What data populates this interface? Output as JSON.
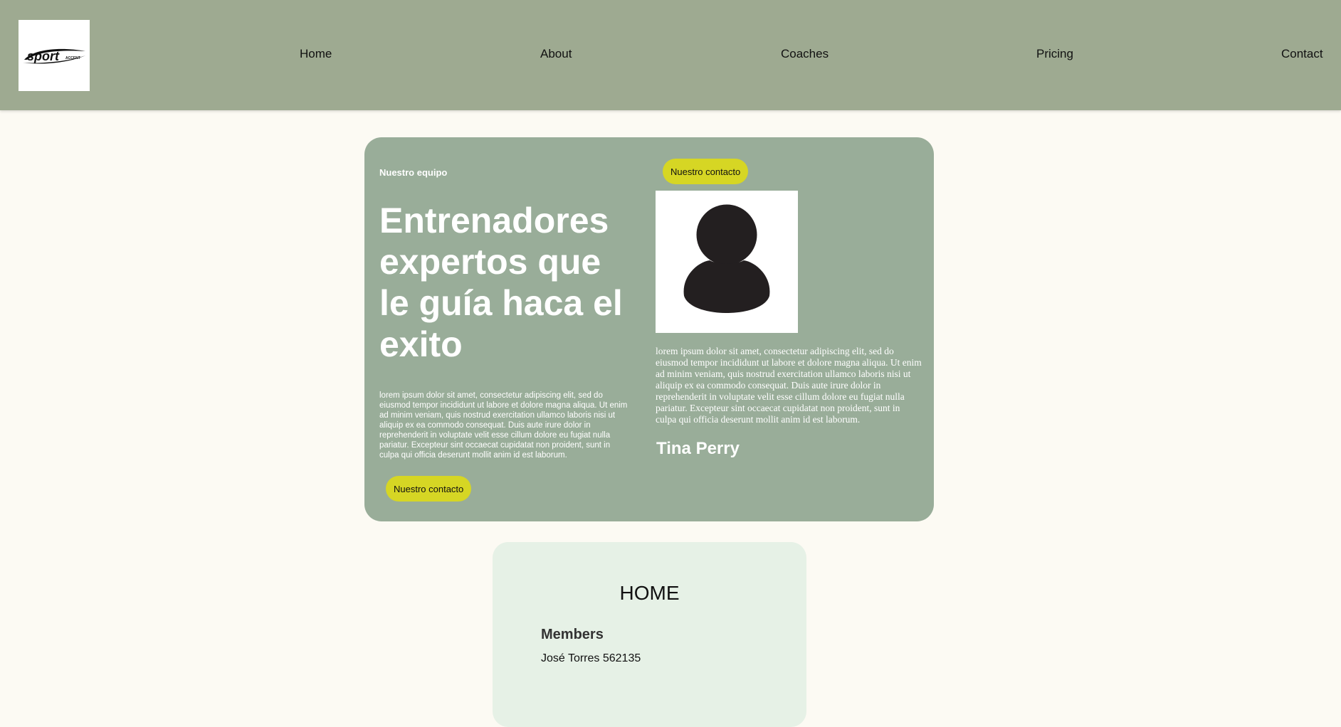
{
  "header": {
    "logo_icon": "sport-logo-icon",
    "nav": [
      "Home",
      "About",
      "Coaches",
      "Pricing",
      "Contact"
    ]
  },
  "hero": {
    "eyebrow": "Nuestro equipo",
    "title": "Entrenadores expertos que le guía haca el exito",
    "text": "lorem ipsum dolor sit amet, consectetur adipiscing elit, sed do eiusmod tempor incididunt ut labore et dolore magna aliqua. Ut enim ad minim veniam, quis nostrud exercitation ullamco laboris nisi ut aliquip ex ea commodo consequat. Duis aute irure dolor in reprehenderit in voluptate velit esse cillum dolore eu fugiat nulla pariatur. Excepteur sint occaecat cupidatat non proident, sunt in culpa qui officia deserunt mollit anim id est laborum.",
    "cta_label": "Nuestro contacto"
  },
  "coach": {
    "contact_label": "Nuestro contacto",
    "avatar_icon": "user-avatar-icon",
    "text": "lorem ipsum dolor sit amet, consectetur adipiscing elit, sed do eiusmod tempor incididunt ut labore et dolore magna aliqua. Ut enim ad minim veniam, quis nostrud exercitation ullamco laboris nisi ut aliquip ex ea commodo consequat. Duis aute irure dolor in reprehenderit in voluptate velit esse cillum dolore eu fugiat nulla pariatur. Excepteur sint occaecat cupidatat non proident, sunt in culpa qui officia deserunt mollit anim id est laborum.",
    "name": "Tina Perry"
  },
  "home_card": {
    "title": "HOME",
    "members_title": "Members",
    "members": [
      "José Torres 562135"
    ]
  },
  "colors": {
    "header_bg": "#9eaa91",
    "hero_bg": "#99ad99",
    "accent_button": "#d6d624",
    "page_bg": "#fcfaf3",
    "card_bg": "#e6f1e6"
  }
}
